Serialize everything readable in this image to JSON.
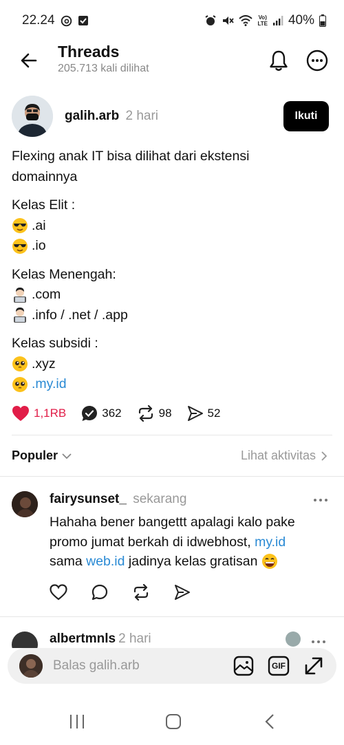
{
  "status_bar": {
    "time": "22.24",
    "battery": "40%",
    "network_label_top": "Vo)",
    "network_label_bottom": "LTE"
  },
  "header": {
    "title": "Threads",
    "views": "205.713 kali dilihat"
  },
  "post": {
    "author": "galih.arb",
    "time": "2 hari",
    "follow_label": "Ikuti",
    "lines": {
      "l1": "Flexing anak IT bisa dilihat dari ekstensi",
      "l2": "domainnya",
      "l3": "Kelas Elit :",
      "l4": ".ai",
      "l5": ".io",
      "l6": "Kelas Menengah:",
      "l7": ".com",
      "l8": ".info / .net / .app",
      "l9": "Kelas subsidi :",
      "l10": ".xyz",
      "l11": ".my.id"
    },
    "stats": {
      "likes": "1,1RB",
      "replies": "362",
      "reposts": "98",
      "shares": "52"
    }
  },
  "sort": {
    "label": "Populer",
    "activity_link": "Lihat aktivitas"
  },
  "reply": {
    "author": "fairysunset_",
    "time": "sekarang",
    "line1": "Hahaha bener bangettt apalagi kalo pake",
    "line2_prefix": "promo jumat berkah di idwebhost, ",
    "line2_link": "my.id",
    "line3_prefix": "sama ",
    "line3_link": "web.id",
    "line3_suffix": " jadinya kelas gratisan"
  },
  "next_reply": {
    "author": "albertmnls",
    "time": "2 hari"
  },
  "reply_bar": {
    "placeholder": "Balas galih.arb",
    "gif_label": "GIF"
  },
  "colors": {
    "like": "#e11d48",
    "link": "#2a8ad4",
    "muted": "#999999"
  }
}
